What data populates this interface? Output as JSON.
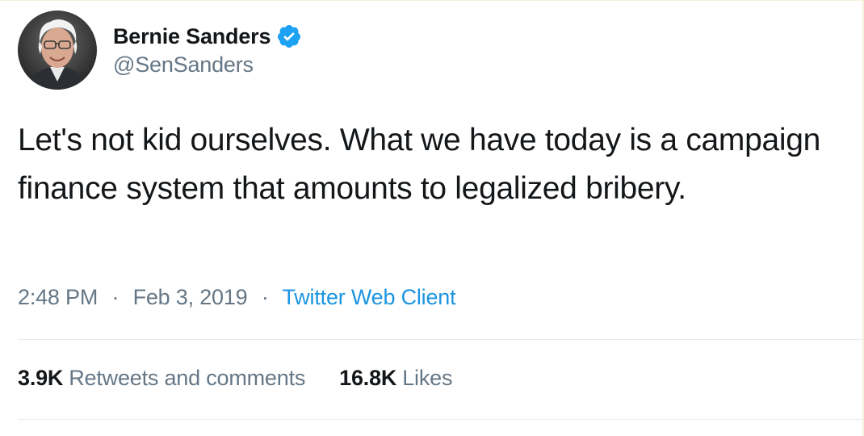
{
  "author": {
    "name": "Bernie Sanders",
    "handle": "@SenSanders",
    "verified": true,
    "avatar_icon": "profile-photo"
  },
  "tweet": {
    "text": "Let's not kid ourselves. What we have today is a campaign finance system that amounts to legalized bribery.",
    "time": "2:48 PM",
    "date": "Feb 3, 2019",
    "separator": "·",
    "client": "Twitter Web Client"
  },
  "stats": {
    "retweets_count": "3.9K",
    "retweets_label": "Retweets and comments",
    "likes_count": "16.8K",
    "likes_label": "Likes"
  },
  "colors": {
    "text": "#14171a",
    "secondary": "#657786",
    "link": "#1b95e0",
    "verified": "#1da1f2",
    "divider": "#e6ecf0"
  }
}
